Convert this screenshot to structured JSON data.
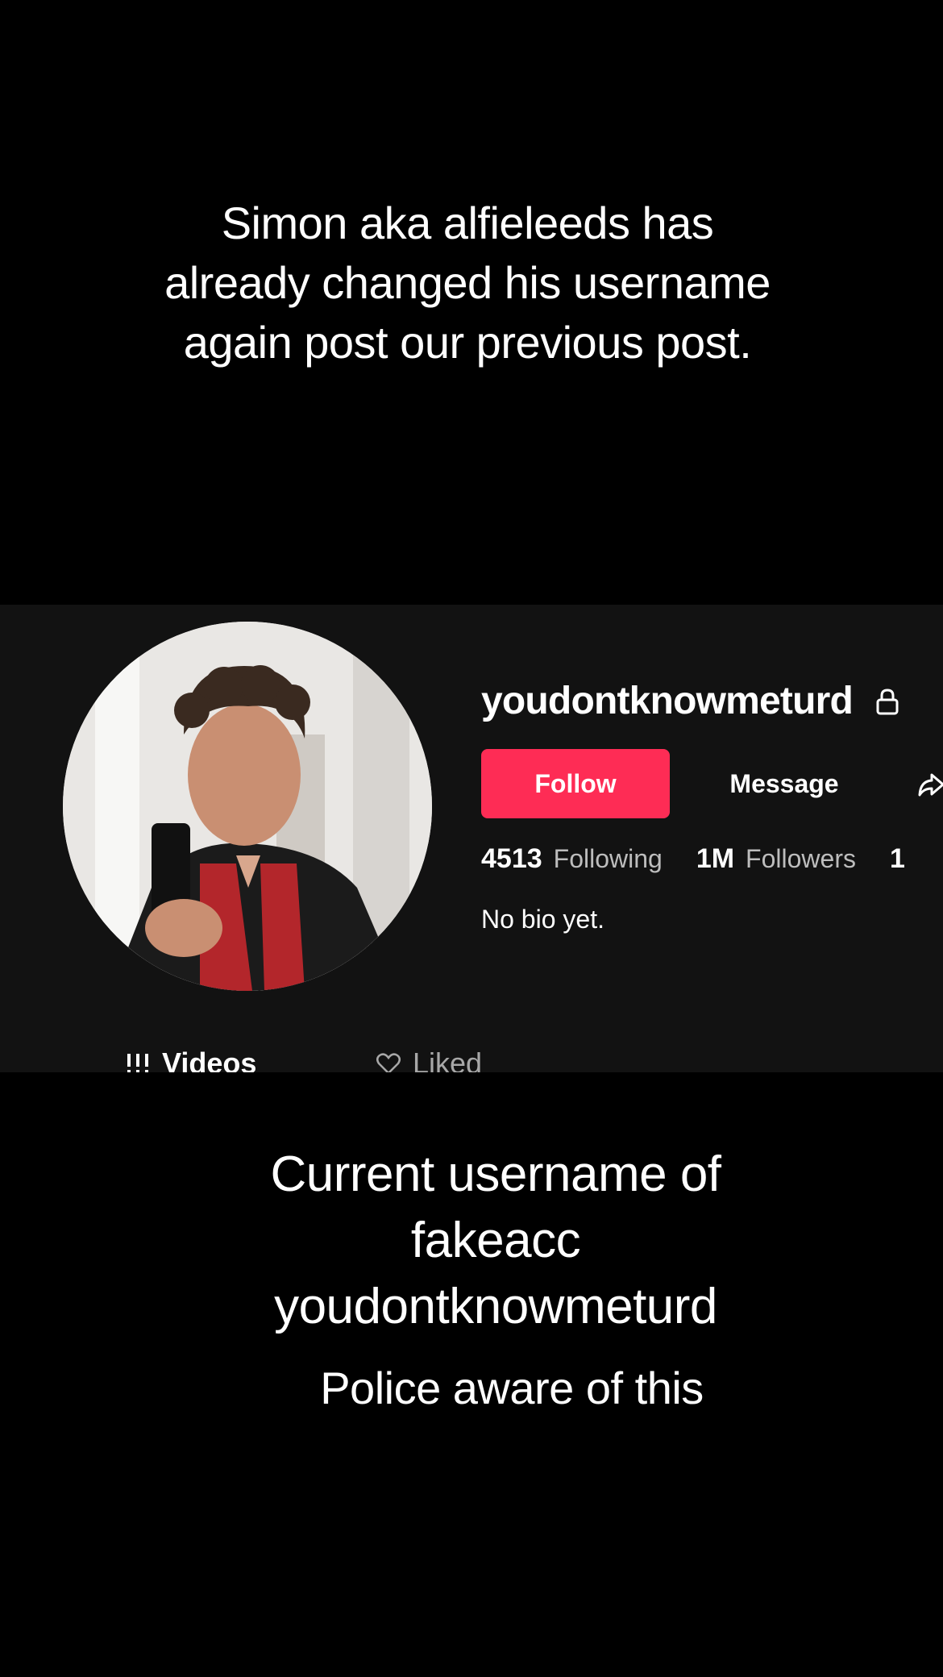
{
  "captions": {
    "top": "Simon aka alfieleeds has already changed his username again post our previous post.",
    "middle_line1": "Current username of",
    "middle_line2": "fakeacc",
    "middle_line3": "youdontknowmeturd",
    "bottom": "Police aware of this"
  },
  "profile": {
    "username": "youdontknowmeturd",
    "follow_label": "Follow",
    "message_label": "Message",
    "following_count": "4513",
    "following_label": "Following",
    "followers_count": "1M",
    "followers_label": "Followers",
    "likes_count_partial": "1",
    "bio": "No bio yet.",
    "tabs": [
      {
        "label": "Videos",
        "icon": "grid-icon"
      },
      {
        "label": "Liked",
        "icon": "heart-outline-icon"
      }
    ]
  },
  "colors": {
    "background": "#000000",
    "panel": "#121212",
    "follow_button": "#fe2c55",
    "secondary_text": "#bdbdbd"
  }
}
